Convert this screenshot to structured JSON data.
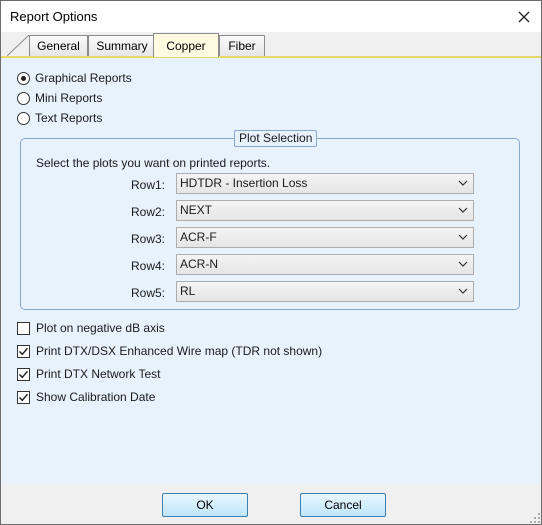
{
  "window": {
    "title": "Report Options"
  },
  "tabs": [
    {
      "label": "General",
      "active": false
    },
    {
      "label": "Summary",
      "active": false
    },
    {
      "label": "Copper",
      "active": true
    },
    {
      "label": "Fiber",
      "active": false
    }
  ],
  "report_type": {
    "options": [
      {
        "label": "Graphical Reports",
        "selected": true
      },
      {
        "label": "Mini Reports",
        "selected": false
      },
      {
        "label": "Text Reports",
        "selected": false
      }
    ]
  },
  "plot_selection": {
    "legend": "Plot Selection",
    "intro": "Select the plots you want on printed reports.",
    "rows": [
      {
        "label": "Row1:",
        "value": "HDTDR - Insertion Loss"
      },
      {
        "label": "Row2:",
        "value": "NEXT"
      },
      {
        "label": "Row3:",
        "value": "ACR-F"
      },
      {
        "label": "Row4:",
        "value": "ACR-N"
      },
      {
        "label": "Row5:",
        "value": "RL"
      }
    ]
  },
  "options": [
    {
      "label": "Plot on negative dB axis",
      "checked": false
    },
    {
      "label": "Print DTX/DSX Enhanced Wire map (TDR not shown)",
      "checked": true
    },
    {
      "label": "Print DTX Network Test",
      "checked": true
    },
    {
      "label": "Show Calibration Date",
      "checked": true
    }
  ],
  "buttons": {
    "ok": "OK",
    "cancel": "Cancel"
  },
  "colors": {
    "panel": "#e8f2fd",
    "active_tab": "#fffbe0",
    "tab_border_accent": "#e6d86a",
    "button_border": "#3c7fb1"
  }
}
